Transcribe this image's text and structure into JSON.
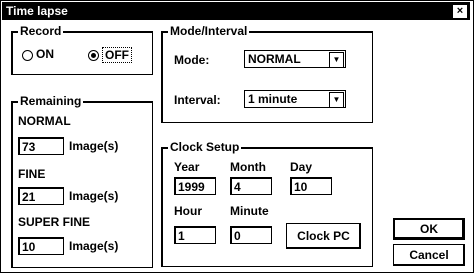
{
  "window": {
    "title": "Time lapse",
    "close_glyph": "×"
  },
  "record": {
    "title": "Record",
    "options": [
      {
        "label": "ON",
        "selected": false
      },
      {
        "label": "OFF",
        "selected": true
      }
    ]
  },
  "remaining": {
    "title": "Remaining",
    "rows": [
      {
        "label": "NORMAL",
        "value": "73",
        "unit": "Image(s)"
      },
      {
        "label": "FINE",
        "value": "21",
        "unit": "Image(s)"
      },
      {
        "label": "SUPER FINE",
        "value": "10",
        "unit": "Image(s)"
      }
    ]
  },
  "mode_interval": {
    "title": "Mode/Interval",
    "mode_label": "Mode:",
    "mode_value": "NORMAL",
    "interval_label": "Interval:",
    "interval_value": "1 minute"
  },
  "clock": {
    "title": "Clock Setup",
    "year_label": "Year",
    "month_label": "Month",
    "day_label": "Day",
    "year": "1999",
    "month": "4",
    "day": "10",
    "hour_label": "Hour",
    "minute_label": "Minute",
    "hour": "1",
    "minute": "0",
    "clock_pc_label": "Clock PC"
  },
  "buttons": {
    "ok": "OK",
    "cancel": "Cancel"
  }
}
